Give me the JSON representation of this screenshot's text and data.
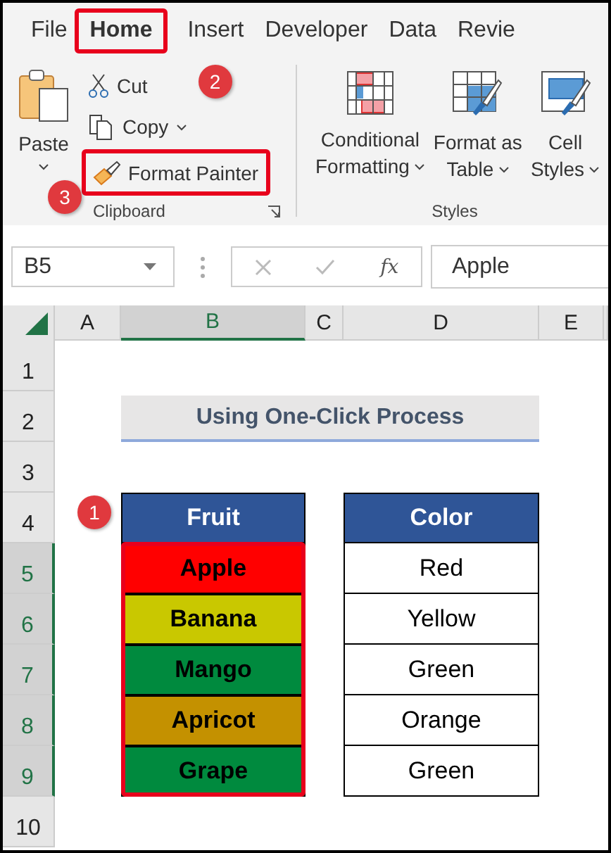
{
  "tabs": [
    {
      "label": "File",
      "selected": false
    },
    {
      "label": "Home",
      "selected": true,
      "callout": "2"
    },
    {
      "label": "Insert",
      "selected": false
    },
    {
      "label": "Developer",
      "selected": false
    },
    {
      "label": "Data",
      "selected": false
    },
    {
      "label": "Revie",
      "selected": false
    }
  ],
  "clipboard": {
    "paste": "Paste",
    "cut": "Cut",
    "copy": "Copy",
    "format_painter": {
      "label": "Format Painter",
      "callout": "3"
    },
    "group_label": "Clipboard"
  },
  "styles": {
    "buttons": [
      {
        "kind": "conditional",
        "line1": "Conditional",
        "line2": "Formatting"
      },
      {
        "kind": "table",
        "line1": "Format as",
        "line2": "Table"
      },
      {
        "kind": "cell",
        "line1": "Cell",
        "line2": "Styles"
      }
    ],
    "group_label": "Styles"
  },
  "formula_bar": {
    "name_box": "B5",
    "fx": "fx",
    "value": "Apple"
  },
  "sheet": {
    "columns": [
      {
        "label": "A",
        "selected": false
      },
      {
        "label": "B",
        "selected": true
      },
      {
        "label": "C",
        "selected": false
      },
      {
        "label": "D",
        "selected": false
      },
      {
        "label": "E",
        "selected": false
      }
    ],
    "rows": [
      {
        "label": "1",
        "selected": false
      },
      {
        "label": "2",
        "selected": false
      },
      {
        "label": "3",
        "selected": false
      },
      {
        "label": "4",
        "selected": false
      },
      {
        "label": "5",
        "selected": true
      },
      {
        "label": "6",
        "selected": true
      },
      {
        "label": "7",
        "selected": true
      },
      {
        "label": "8",
        "selected": true
      },
      {
        "label": "9",
        "selected": true
      },
      {
        "label": "10",
        "selected": false
      }
    ],
    "title": "Using One-Click Process",
    "headers": [
      "Fruit",
      "Color"
    ],
    "items": [
      {
        "fruit": "Apple",
        "color": "#ff0000",
        "color_name": "Red"
      },
      {
        "fruit": "Banana",
        "color": "#c9c800",
        "color_name": "Yellow"
      },
      {
        "fruit": "Mango",
        "color": "#008a3e",
        "color_name": "Green"
      },
      {
        "fruit": "Apricot",
        "color": "#c49100",
        "color_name": "Orange"
      },
      {
        "fruit": "Grape",
        "color": "#008a3e",
        "color_name": "Green"
      }
    ],
    "selection_callout": "1"
  }
}
